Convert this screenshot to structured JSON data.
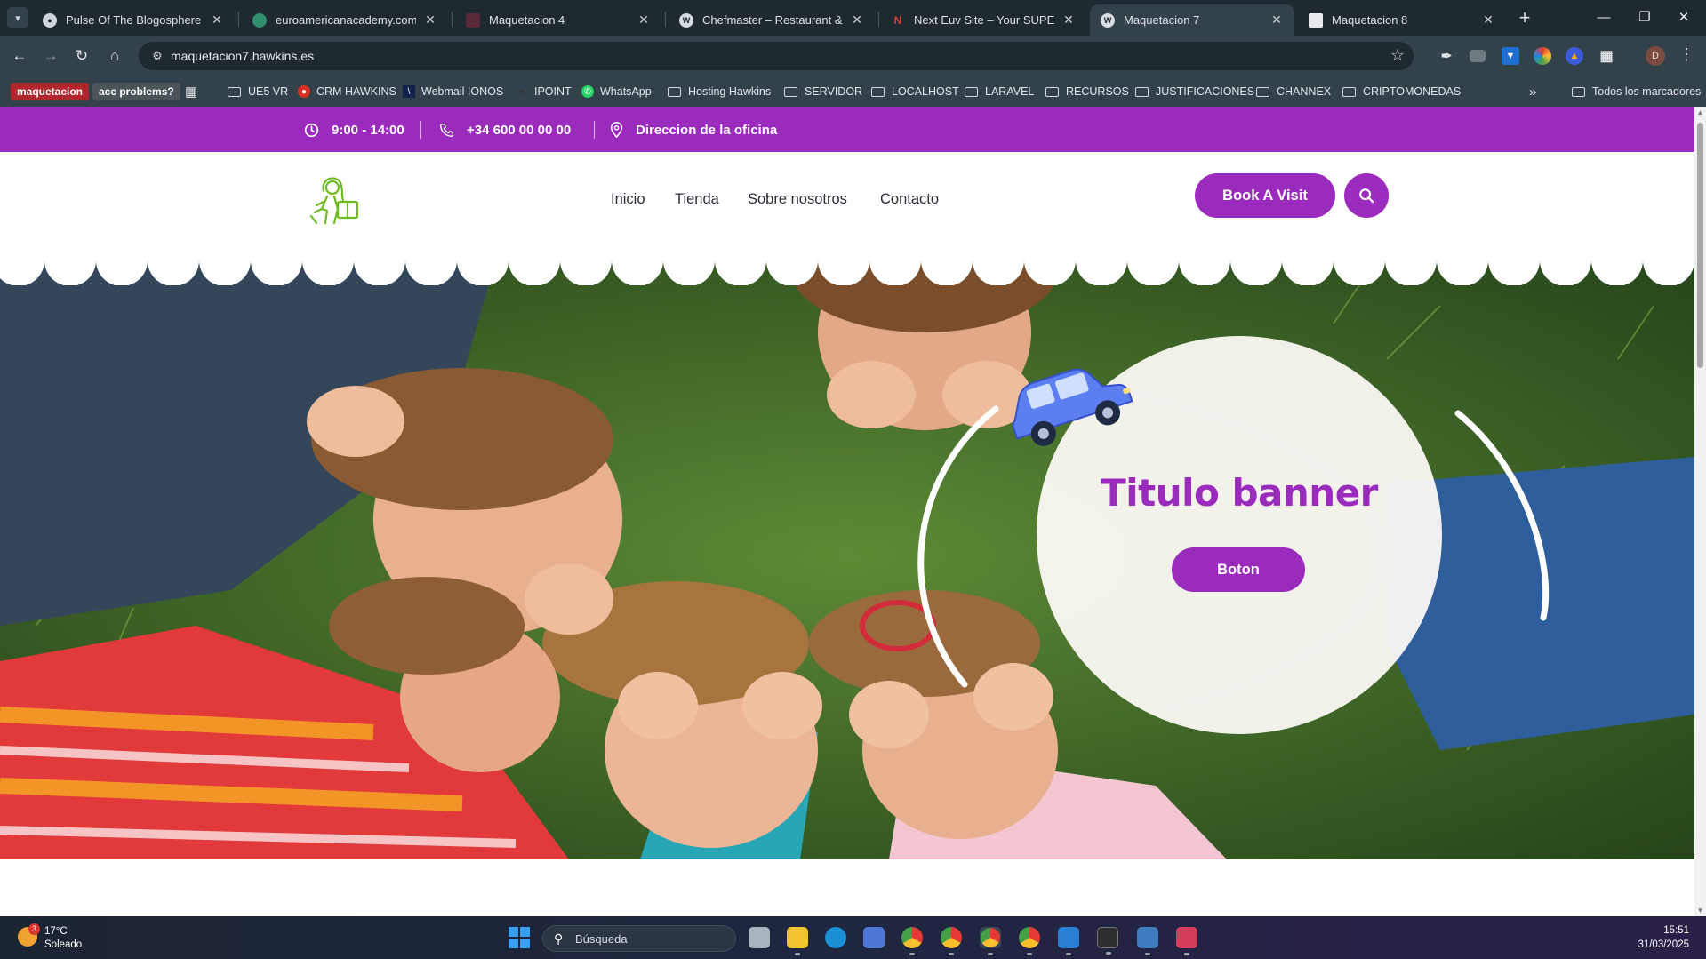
{
  "browser": {
    "tabs": [
      {
        "title": "Pulse Of The Blogosphere",
        "favicon": "globe-icon",
        "active": false
      },
      {
        "title": "euroamericanacademy.com – el",
        "favicon": "site-icon",
        "active": false
      },
      {
        "title": "Maquetacion 4",
        "favicon": "site-icon",
        "active": false
      },
      {
        "title": "Chefmaster – Restaurant & Coff",
        "favicon": "wordpress-icon",
        "active": false
      },
      {
        "title": "Next Euv Site – Your SUPER-po",
        "favicon": "n-icon",
        "active": false
      },
      {
        "title": "Maquetacion 7",
        "favicon": "wordpress-icon",
        "active": true
      },
      {
        "title": "Maquetacion 8",
        "favicon": "page-icon",
        "active": false
      }
    ],
    "url": "maquetacion7.hawkins.es",
    "bookmarks": [
      {
        "label": "maquetacion",
        "type": "pill",
        "color": "#b0272d"
      },
      {
        "label": "acc problems?",
        "type": "pill",
        "color": "#4b5459"
      },
      {
        "label": "",
        "type": "apps"
      },
      {
        "label": "UE5 VR",
        "type": "folder"
      },
      {
        "label": "CRM HAWKINS",
        "type": "site"
      },
      {
        "label": "Webmail IONOS",
        "type": "site"
      },
      {
        "label": "IPOINT",
        "type": "site"
      },
      {
        "label": "WhatsApp",
        "type": "site"
      },
      {
        "label": "Hosting Hawkins",
        "type": "folder"
      },
      {
        "label": "SERVIDOR",
        "type": "folder"
      },
      {
        "label": "LOCALHOST",
        "type": "folder"
      },
      {
        "label": "LARAVEL",
        "type": "folder"
      },
      {
        "label": "RECURSOS",
        "type": "folder"
      },
      {
        "label": "JUSTIFICACIONES",
        "type": "folder"
      },
      {
        "label": "CHANNEX",
        "type": "folder"
      },
      {
        "label": "CRIPTOMONEDAS",
        "type": "folder"
      }
    ],
    "more_bookmarks": "»",
    "all_bookmarks": "Todos los marcadores",
    "profile_initial": "D"
  },
  "site": {
    "topbar": {
      "hours": "9:00 - 14:00",
      "phone": "+34 600 00 00 00",
      "address": "Direccion de la oficina"
    },
    "nav": [
      "Inicio",
      "Tienda",
      "Sobre nosotros",
      "Contacto"
    ],
    "cta": "Book A Visit",
    "banner": {
      "title": "Titulo banner",
      "button": "Boton"
    }
  },
  "taskbar": {
    "weather": {
      "temp": "17°C",
      "condition": "Soleado",
      "badge": "3"
    },
    "search_placeholder": "Búsqueda",
    "time": "15:51",
    "date": "31/03/2025"
  },
  "colors": {
    "brand": "#9b2bbd",
    "topbar_bg": "#9b2bbd",
    "logo_green": "#6dbb1e",
    "car_blue": "#5b7ff0"
  }
}
